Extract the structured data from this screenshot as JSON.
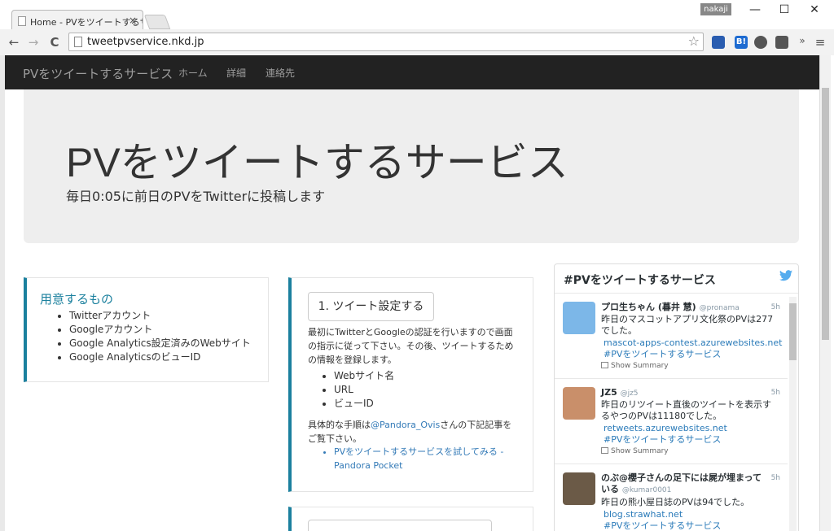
{
  "browser": {
    "tab_title": "Home - PVをツイートするサービ",
    "tab_close": "×",
    "profile": "nakaji",
    "window_controls": [
      "—",
      "☐",
      "✕"
    ],
    "url": "tweetpvservice.nkd.jp",
    "nav": {
      "back": "←",
      "forward": "→",
      "reload": "C"
    },
    "star": "☆",
    "menu": "≡",
    "overflow": "»",
    "extensions": [
      {
        "name": "ext-blue",
        "label": "",
        "color": "#2a5db0"
      },
      {
        "name": "hatena-bookmark",
        "label": "B!",
        "color": "#1d6bd1"
      },
      {
        "name": "evernote",
        "label": "",
        "color": "#555555"
      },
      {
        "name": "pocket",
        "label": "",
        "color": "#555555"
      }
    ]
  },
  "navbar": {
    "brand": "PVをツイートするサービス",
    "links": [
      "ホーム",
      "詳細",
      "連絡先"
    ]
  },
  "jumbotron": {
    "title": "PVをツイートするサービス",
    "subtitle": "毎日0:05に前日のPVをTwitterに投稿します"
  },
  "requirements": {
    "heading": "用意するもの",
    "items": [
      "Twitterアカウント",
      "Googleアカウント",
      "Google Analytics設定済みのWebサイト",
      "Google AnalyticsのビューID"
    ]
  },
  "step1": {
    "button": "1. ツイート設定する",
    "description": "最初にTwitterとGoogleの認証を行いますので画面の指示に従って下さい。その後、ツイートするための情報を登録します。",
    "items": [
      "Webサイト名",
      "URL",
      "ビューID"
    ],
    "procedure_prefix": "具体的な手順は",
    "procedure_link": "@Pandora_Ovis",
    "procedure_suffix": "さんの下記記事をご覧下さい。",
    "article_link": "PVをツイートするサービスを試してみる - Pandora Pocket"
  },
  "twitter": {
    "title": "#PVをツイートするサービス",
    "bird": "🐦",
    "tweets": [
      {
        "name": "プロ生ちゃん (暮井 慧)",
        "handle": "@pronama",
        "time": "5h",
        "text": "昨日のマスコットアプリ文化祭のPVは277でした。",
        "link": "mascot-apps-contest.azurewebsites.net",
        "hashtag": "#PVをツイートするサービス",
        "summary": "Show Summary",
        "avatar_color": "#7cb7e8"
      },
      {
        "name": "JZ5",
        "handle": "@jz5",
        "time": "5h",
        "text": "昨日のリツイート直後のツイートを表示するやつのPVは11180でした。",
        "link": "retweets.azurewebsites.net",
        "hashtag": "#PVをツイートするサービス",
        "summary": "Show Summary",
        "avatar_color": "#c98f6a"
      },
      {
        "name": "のぶ@櫻子さんの足下には屍が埋まっている",
        "handle": "@kumar0001",
        "time": "5h",
        "text": "昨日の熊小屋日誌のPVは94でした。",
        "link": "blog.strawhat.net",
        "hashtag": "#PVをツイートするサービス",
        "summary": "",
        "avatar_color": "#6b5a47"
      }
    ]
  },
  "colors": {
    "navbar_bg": "#222222",
    "accent": "#1b809e",
    "link": "#337ab7",
    "twitter_blue": "#55acee"
  }
}
